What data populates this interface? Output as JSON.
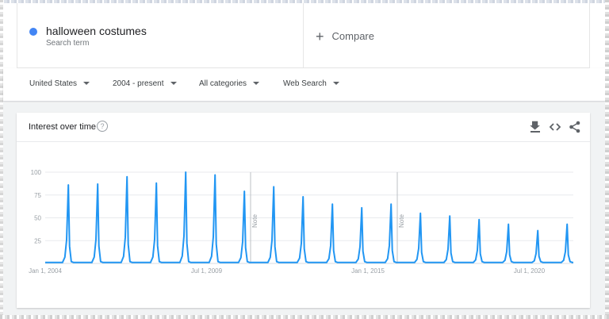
{
  "search_term": {
    "name": "halloween costumes",
    "subtitle": "Search term",
    "color": "#4285f4"
  },
  "compare_label": "Compare",
  "filters": {
    "region": "United States",
    "time_range": "2004 - present",
    "category": "All categories",
    "search_type": "Web Search"
  },
  "card": {
    "title": "Interest over time",
    "help_symbol": "?"
  },
  "icons": [
    "download-icon",
    "embed-code-icon",
    "share-icon"
  ],
  "chart_data": {
    "type": "line",
    "title": "Interest over time",
    "xlabel": "",
    "ylabel": "",
    "ylim": [
      0,
      100
    ],
    "yticks": [
      25,
      50,
      75,
      100
    ],
    "xlim": [
      2004.0,
      2022.0
    ],
    "xtick_labels": [
      {
        "label": "Jan 1, 2004",
        "x": 2004.0
      },
      {
        "label": "Jul 1, 2009",
        "x": 2009.5
      },
      {
        "label": "Jan 1, 2015",
        "x": 2015.0
      },
      {
        "label": "Jul 1, 2020",
        "x": 2020.5
      }
    ],
    "notes": [
      {
        "label": "Note",
        "x": 2011.0
      },
      {
        "label": "Note",
        "x": 2016.0
      }
    ],
    "grid": true,
    "series": [
      {
        "name": "halloween costumes",
        "color": "#2196f3",
        "baseline": 1,
        "peaks": [
          {
            "x": 2004.79,
            "value": 86
          },
          {
            "x": 2005.79,
            "value": 87
          },
          {
            "x": 2006.79,
            "value": 95
          },
          {
            "x": 2007.79,
            "value": 88
          },
          {
            "x": 2008.79,
            "value": 100
          },
          {
            "x": 2009.79,
            "value": 97
          },
          {
            "x": 2010.79,
            "value": 79
          },
          {
            "x": 2011.79,
            "value": 84
          },
          {
            "x": 2012.79,
            "value": 73
          },
          {
            "x": 2013.79,
            "value": 65
          },
          {
            "x": 2014.79,
            "value": 61
          },
          {
            "x": 2015.79,
            "value": 65
          },
          {
            "x": 2016.79,
            "value": 55
          },
          {
            "x": 2017.79,
            "value": 52
          },
          {
            "x": 2018.79,
            "value": 48
          },
          {
            "x": 2019.79,
            "value": 43
          },
          {
            "x": 2020.79,
            "value": 36
          },
          {
            "x": 2021.79,
            "value": 43
          }
        ]
      }
    ]
  }
}
